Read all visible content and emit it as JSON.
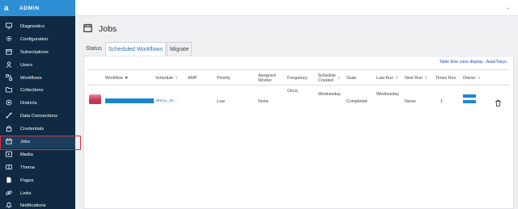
{
  "brand": {
    "logo": "a",
    "name": "ADMIN"
  },
  "sidebar": {
    "items": [
      {
        "label": "Diagnostics",
        "icon": "monitor-icon"
      },
      {
        "label": "Configuration",
        "icon": "gear-icon"
      },
      {
        "label": "Subscriptions",
        "icon": "calendar-icon"
      },
      {
        "label": "Users",
        "icon": "user-icon"
      },
      {
        "label": "Workflows",
        "icon": "workflow-icon"
      },
      {
        "label": "Collections",
        "icon": "folder-icon"
      },
      {
        "label": "Districts",
        "icon": "districts-icon"
      },
      {
        "label": "Data Connections",
        "icon": "link-icon"
      },
      {
        "label": "Credentials",
        "icon": "lock-icon"
      },
      {
        "label": "Jobs",
        "icon": "jobs-icon",
        "active": true
      },
      {
        "label": "Media",
        "icon": "media-icon"
      },
      {
        "label": "Theme",
        "icon": "theme-icon"
      },
      {
        "label": "Pages",
        "icon": "page-icon"
      },
      {
        "label": "Links",
        "icon": "chain-icon"
      },
      {
        "label": "Notifications",
        "icon": "bell-icon"
      }
    ]
  },
  "page": {
    "title": "Jobs"
  },
  "tabs": [
    {
      "label": "Status"
    },
    {
      "label": "Scheduled Workflows",
      "selected": true
    },
    {
      "label": "Migrate"
    }
  ],
  "timezone": {
    "label": "Table time zone display - Asia/Tokyo"
  },
  "table": {
    "headers": {
      "workflow": "Workflow",
      "schedule": "Schedule",
      "amp": "AMP",
      "priority": "Priority",
      "assigned_worker": [
        "Assigned",
        "Worker"
      ],
      "frequency": "Frequency",
      "schedule_created": [
        "Schedule",
        "Created"
      ],
      "state": "State",
      "last_run": "Last Run",
      "next_run": "Next Run",
      "times_run": "Times Run",
      "owner": "Owner"
    },
    "rows": [
      {
        "schedule": "Alteryx_Sc...",
        "priority": "Low",
        "assigned_worker": "None",
        "frequency": "Once,",
        "schedule_created": "Wednesday",
        "state": "Completed",
        "last_run": "Wednesday",
        "next_run": "Never",
        "times_run": "1"
      }
    ]
  },
  "colors": {
    "sidebar": "#102a43",
    "brand": "#2f8fd4",
    "accent": "#1a86d2",
    "highlight": "#d9303a"
  }
}
